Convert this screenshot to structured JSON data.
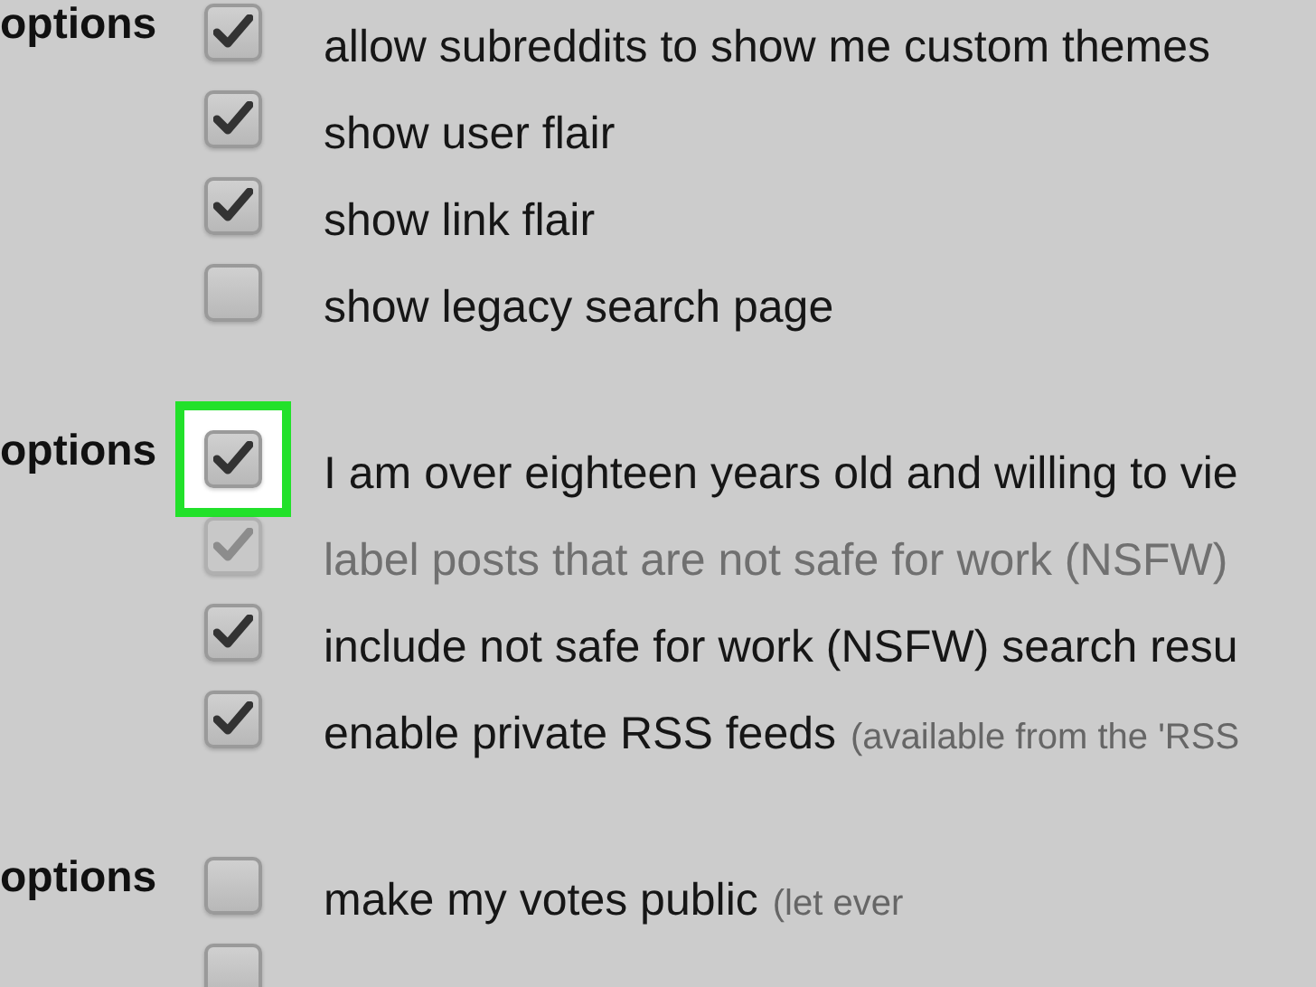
{
  "sections": [
    {
      "label": "options",
      "items": [
        {
          "label": "allow subreddits to show me custom themes",
          "checked": true,
          "disabled": false,
          "highlighted": false
        },
        {
          "label": "show user flair",
          "checked": true,
          "disabled": false,
          "highlighted": false
        },
        {
          "label": "show link flair",
          "checked": true,
          "disabled": false,
          "highlighted": false
        },
        {
          "label": "show legacy search page",
          "checked": false,
          "disabled": false,
          "highlighted": false
        }
      ]
    },
    {
      "label": "options",
      "items": [
        {
          "label": "I am over eighteen years old and willing to vie",
          "checked": true,
          "disabled": false,
          "highlighted": true
        },
        {
          "label": "label posts that are not safe for work (NSFW)",
          "checked": true,
          "disabled": true,
          "highlighted": false
        },
        {
          "label": "include not safe for work (NSFW) search resu",
          "checked": true,
          "disabled": false,
          "highlighted": false
        },
        {
          "label": "enable private RSS feeds",
          "hint": "(available from the 'RSS",
          "checked": true,
          "disabled": false,
          "highlighted": false
        }
      ]
    },
    {
      "label": "options",
      "items": [
        {
          "label": "make my votes public",
          "hint": "(let ever",
          "checked": false,
          "disabled": false,
          "highlighted": false
        },
        {
          "checked": false,
          "disabled": false,
          "highlighted": false
        }
      ]
    }
  ]
}
